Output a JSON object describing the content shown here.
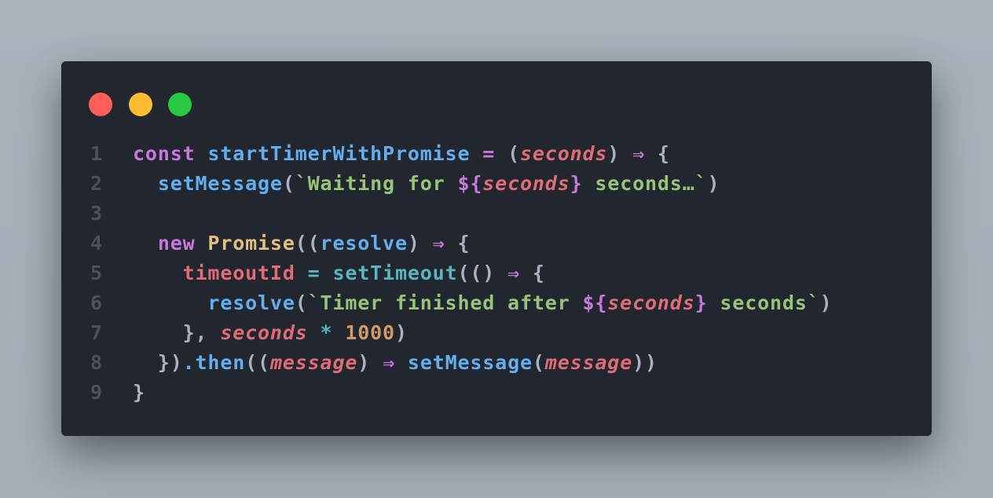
{
  "window": {
    "controls": [
      "close",
      "minimize",
      "maximize"
    ],
    "colors": {
      "background": "#22262e",
      "close": "#fe5f58",
      "minimize": "#febc2e",
      "maximize": "#28c840"
    }
  },
  "code": {
    "lines": [
      {
        "number": "1",
        "tokens": [
          {
            "t": "const ",
            "c": "kw"
          },
          {
            "t": "startTimerWithPromise",
            "c": "fn"
          },
          {
            "t": " = ",
            "c": "op"
          },
          {
            "t": "(",
            "c": "punc"
          },
          {
            "t": "seconds",
            "c": "param"
          },
          {
            "t": ") ",
            "c": "punc"
          },
          {
            "t": "⇒",
            "c": "op"
          },
          {
            "t": " {",
            "c": "punc"
          }
        ]
      },
      {
        "number": "2",
        "tokens": [
          {
            "t": "  ",
            "c": "punc"
          },
          {
            "t": "setMessage",
            "c": "fn"
          },
          {
            "t": "(",
            "c": "punc"
          },
          {
            "t": "`Waiting for ",
            "c": "str"
          },
          {
            "t": "${",
            "c": "kw"
          },
          {
            "t": "seconds",
            "c": "param"
          },
          {
            "t": "}",
            "c": "kw"
          },
          {
            "t": " seconds…`",
            "c": "str"
          },
          {
            "t": ")",
            "c": "punc"
          }
        ]
      },
      {
        "number": "3",
        "tokens": []
      },
      {
        "number": "4",
        "tokens": [
          {
            "t": "  ",
            "c": "punc"
          },
          {
            "t": "new ",
            "c": "kw"
          },
          {
            "t": "Promise",
            "c": "cls"
          },
          {
            "t": "((",
            "c": "punc"
          },
          {
            "t": "resolve",
            "c": "fn"
          },
          {
            "t": ") ",
            "c": "punc"
          },
          {
            "t": "⇒",
            "c": "op"
          },
          {
            "t": " {",
            "c": "punc"
          }
        ]
      },
      {
        "number": "5",
        "tokens": [
          {
            "t": "    ",
            "c": "punc"
          },
          {
            "t": "timeoutId",
            "c": "var"
          },
          {
            "t": " = ",
            "c": "cyan"
          },
          {
            "t": "setTimeout",
            "c": "cyan"
          },
          {
            "t": "(() ",
            "c": "punc"
          },
          {
            "t": "⇒",
            "c": "op"
          },
          {
            "t": " {",
            "c": "punc"
          }
        ]
      },
      {
        "number": "6",
        "tokens": [
          {
            "t": "      ",
            "c": "punc"
          },
          {
            "t": "resolve",
            "c": "fn"
          },
          {
            "t": "(",
            "c": "punc"
          },
          {
            "t": "`Timer finished after ",
            "c": "str"
          },
          {
            "t": "${",
            "c": "kw"
          },
          {
            "t": "seconds",
            "c": "param"
          },
          {
            "t": "}",
            "c": "kw"
          },
          {
            "t": " seconds`",
            "c": "str"
          },
          {
            "t": ")",
            "c": "punc"
          }
        ]
      },
      {
        "number": "7",
        "tokens": [
          {
            "t": "    }, ",
            "c": "punc"
          },
          {
            "t": "seconds",
            "c": "param"
          },
          {
            "t": " * ",
            "c": "cyan"
          },
          {
            "t": "1000",
            "c": "num"
          },
          {
            "t": ")",
            "c": "punc"
          }
        ]
      },
      {
        "number": "8",
        "tokens": [
          {
            "t": "  })",
            "c": "punc"
          },
          {
            "t": ".then",
            "c": "fn"
          },
          {
            "t": "((",
            "c": "punc"
          },
          {
            "t": "message",
            "c": "param"
          },
          {
            "t": ") ",
            "c": "punc"
          },
          {
            "t": "⇒",
            "c": "op"
          },
          {
            "t": " ",
            "c": "punc"
          },
          {
            "t": "setMessage",
            "c": "fn"
          },
          {
            "t": "(",
            "c": "punc"
          },
          {
            "t": "message",
            "c": "param"
          },
          {
            "t": "))",
            "c": "punc"
          }
        ]
      },
      {
        "number": "9",
        "tokens": [
          {
            "t": "}",
            "c": "punc"
          }
        ]
      }
    ]
  }
}
